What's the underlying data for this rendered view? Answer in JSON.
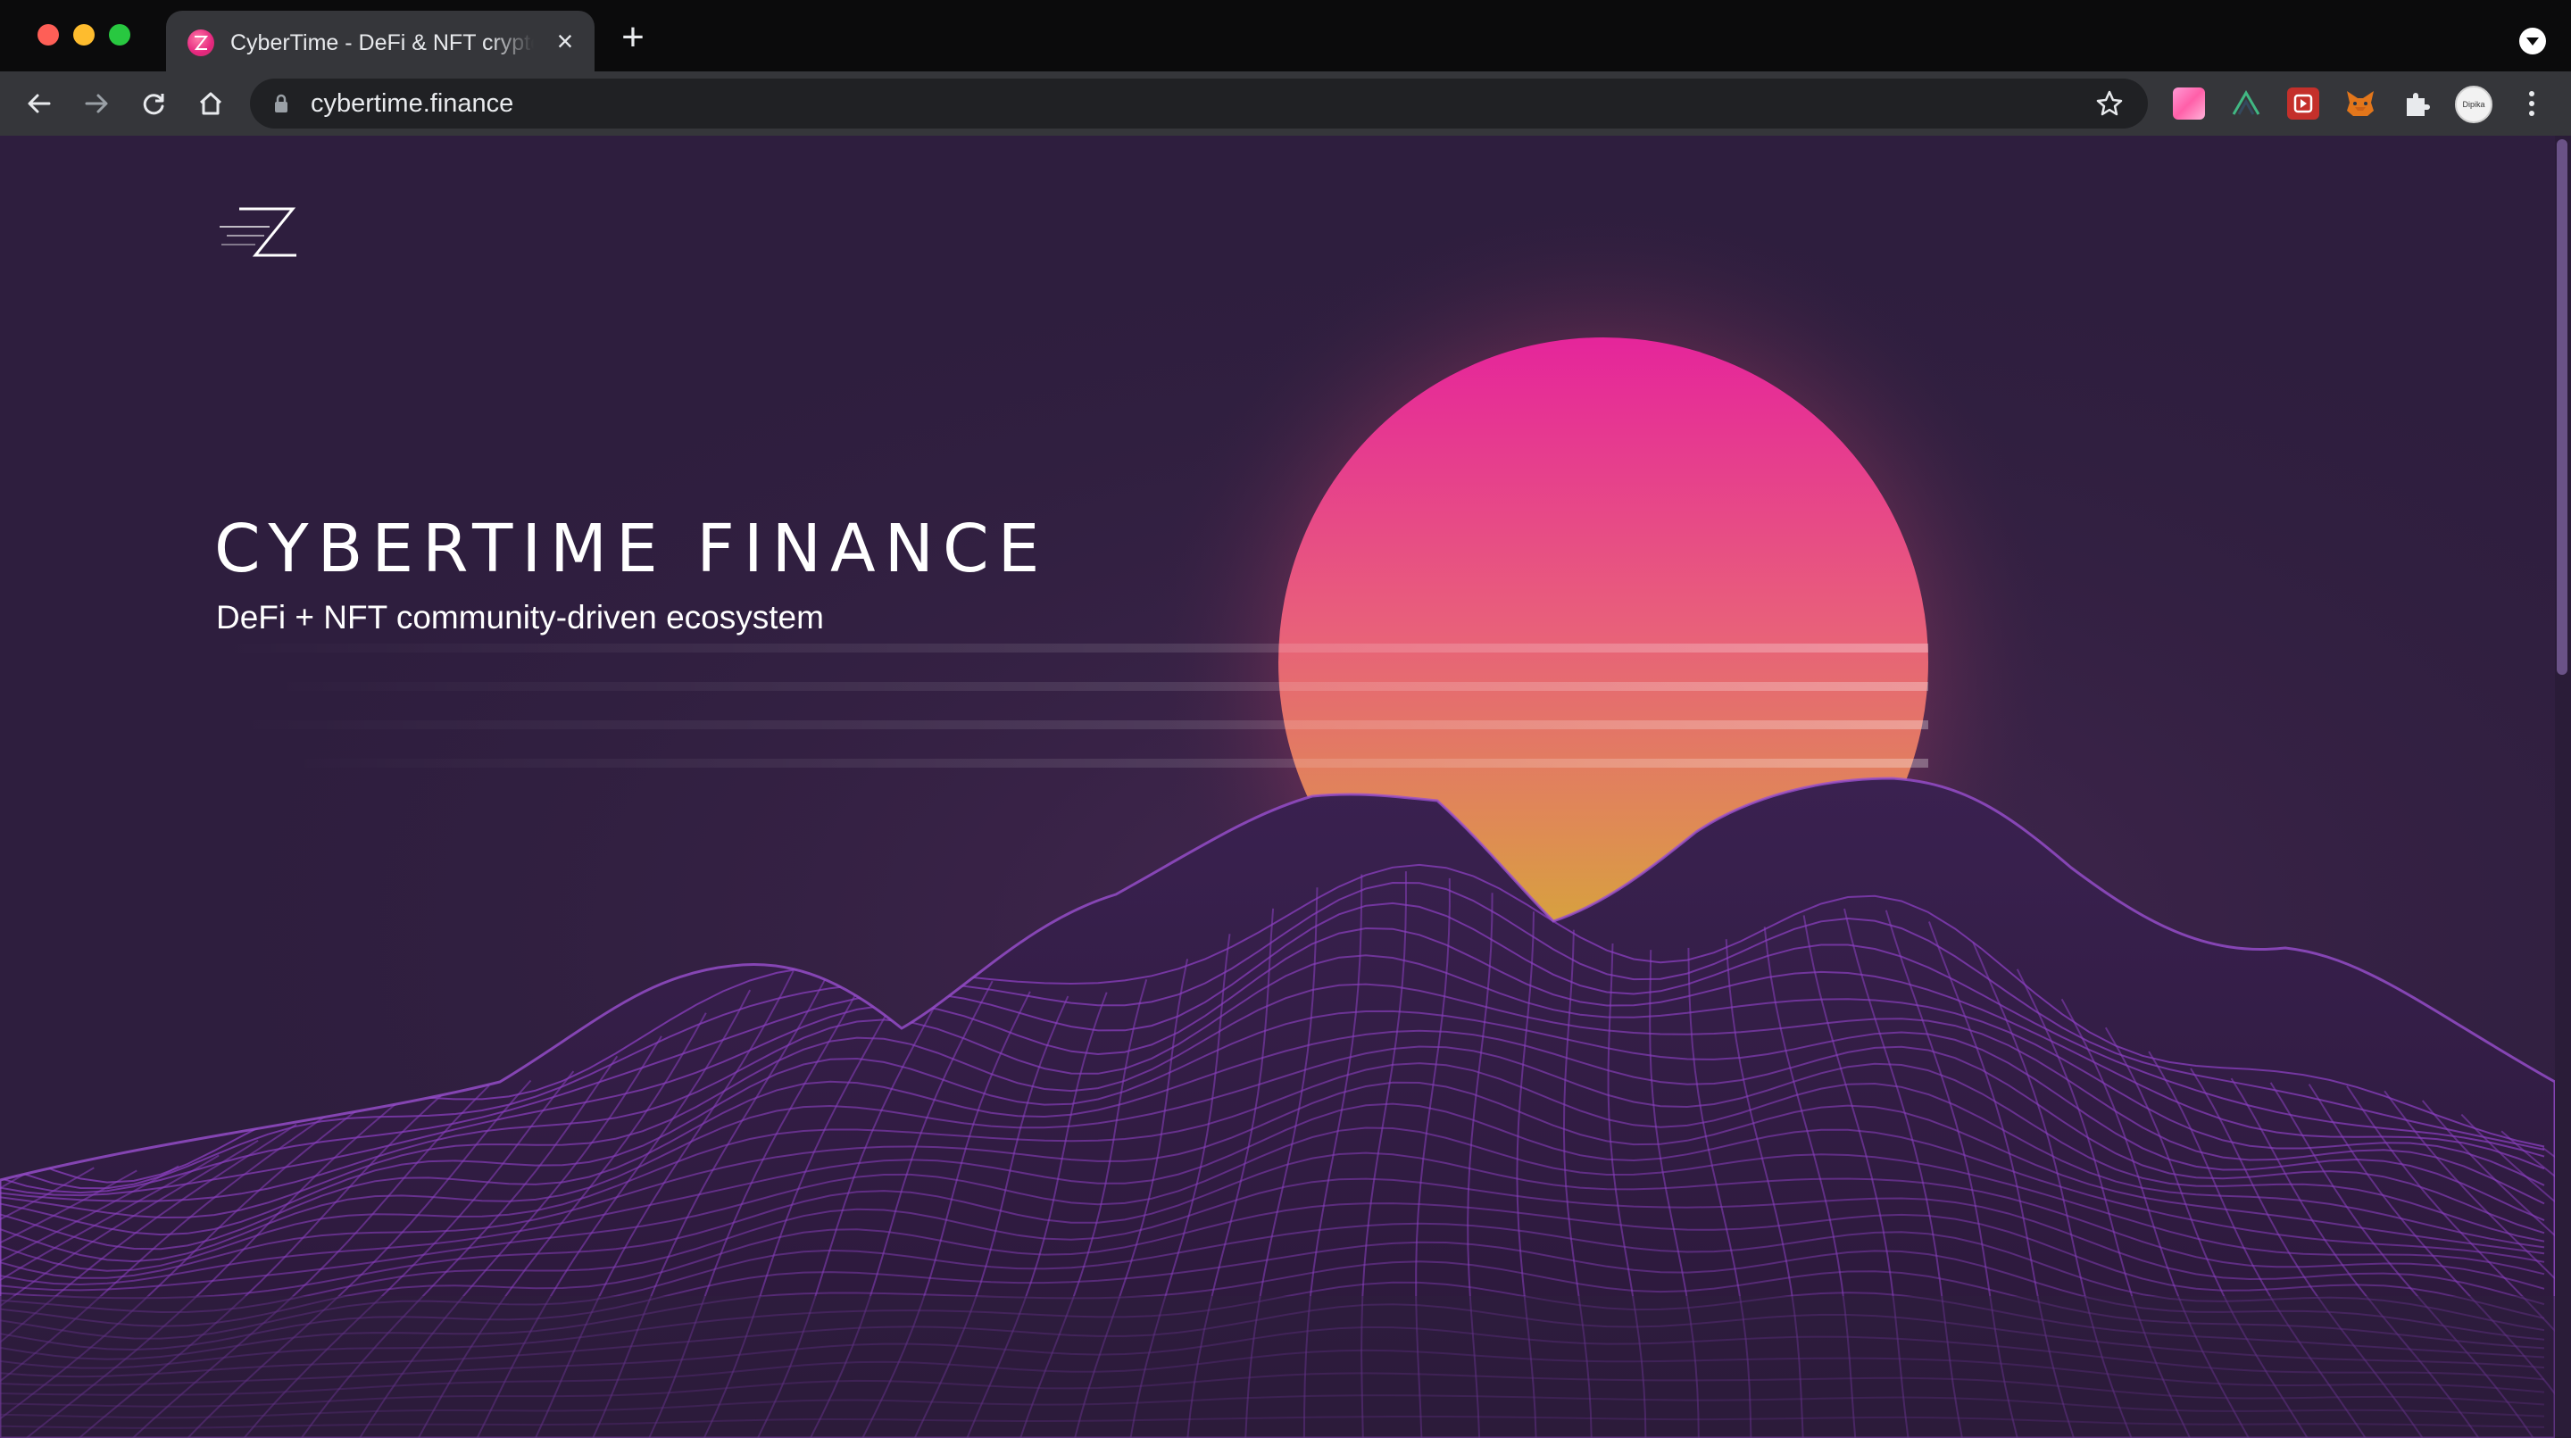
{
  "browser": {
    "tab": {
      "title": "CyberTime - DeFi & NFT crypto",
      "favicon": "cybertime-favicon-icon",
      "close_label": "×"
    },
    "new_tab_label": "+",
    "address": {
      "url": "cybertime.finance",
      "secure": true
    },
    "extensions": [
      "gradient-square-extension-icon",
      "vue-devtools-icon",
      "red-play-extension-icon",
      "metamask-fox-icon",
      "puzzle-extensions-icon"
    ],
    "profile_label": "Dipika Ameta",
    "traffic_light_colors": [
      "#fe5f57",
      "#febc2e",
      "#28c840"
    ]
  },
  "page": {
    "logo": "cybertime-logo-icon",
    "hero": {
      "title": "CYBERTIME FINANCE",
      "subtitle": "DeFi + NFT community-driven ecosystem"
    },
    "colors": {
      "background": "#2e1e3e",
      "sun_top": "#e5259b",
      "sun_mid": "#e8607a",
      "sun_bottom": "#d8a83a",
      "wireframe": "#8b3fc0"
    }
  }
}
